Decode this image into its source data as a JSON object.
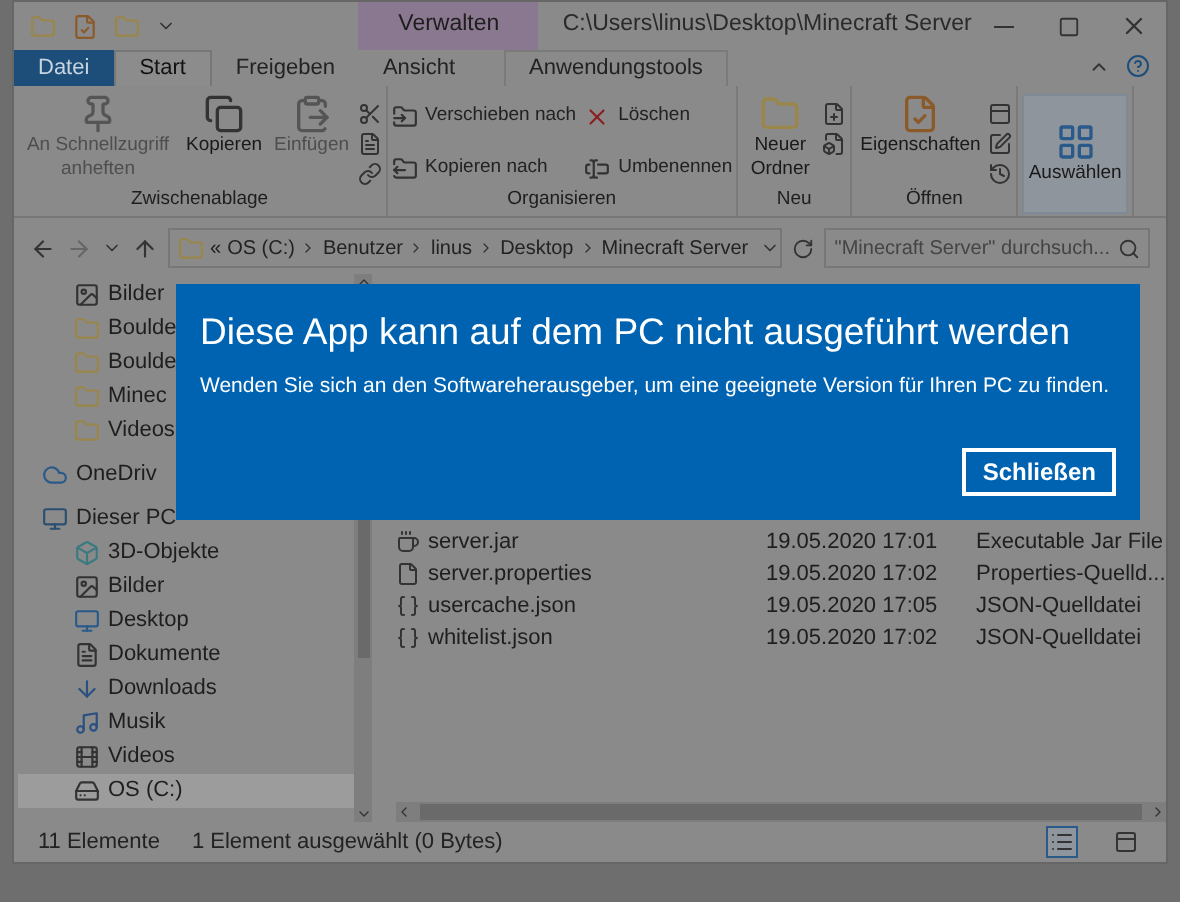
{
  "window": {
    "title": "C:\\Users\\linus\\Desktop\\Minecraft Server",
    "context_tab": "Verwalten"
  },
  "tabs": [
    {
      "label": "Datei",
      "selected": false
    },
    {
      "label": "Start",
      "selected": true
    },
    {
      "label": "Freigeben",
      "selected": false
    },
    {
      "label": "Ansicht",
      "selected": false
    },
    {
      "label": "Anwendungstools",
      "selected": false
    }
  ],
  "ribbon": {
    "groups": [
      {
        "label": "Zwischenablage",
        "buttons": [
          {
            "label": "An Schnellzugriff anheften",
            "disabled": true
          },
          {
            "label": "Kopieren",
            "disabled": false
          },
          {
            "label": "Einfügen",
            "disabled": true
          }
        ]
      },
      {
        "label": "Organisieren",
        "rows": [
          {
            "label": "Verschieben nach"
          },
          {
            "label": "Löschen"
          },
          {
            "label": "Kopieren nach"
          },
          {
            "label": "Umbenennen"
          }
        ]
      },
      {
        "label": "Neu",
        "buttons": [
          {
            "label": "Neuer Ordner",
            "disabled": false
          }
        ]
      },
      {
        "label": "Öffnen",
        "buttons": [
          {
            "label": "Eigenschaften",
            "disabled": false
          }
        ]
      },
      {
        "buttons": [
          {
            "label": "Auswählen",
            "disabled": false
          }
        ]
      }
    ]
  },
  "address": {
    "crumbs": [
      "OS (C:)",
      "Benutzer",
      "linus",
      "Desktop",
      "Minecraft Server"
    ],
    "overflow": "«",
    "search_placeholder": "\"Minecraft Server\" durchsuch..."
  },
  "sidebar": {
    "sections": [
      {
        "items": [
          {
            "label": "Bilder",
            "selected": false
          },
          {
            "label": "Boulde",
            "selected": false
          },
          {
            "label": "Boulde",
            "selected": false
          },
          {
            "label": "Minec",
            "selected": false
          },
          {
            "label": "Videos",
            "selected": false
          }
        ]
      },
      {
        "items": [
          {
            "label": "OneDriv",
            "selected": false
          }
        ]
      },
      {
        "items": [
          {
            "label": "Dieser PC",
            "selected": false,
            "children": [
              {
                "label": "3D-Objekte",
                "selected": false
              },
              {
                "label": "Bilder",
                "selected": false
              },
              {
                "label": "Desktop",
                "selected": false
              },
              {
                "label": "Dokumente",
                "selected": false
              },
              {
                "label": "Downloads",
                "selected": false
              },
              {
                "label": "Musik",
                "selected": false
              },
              {
                "label": "Videos",
                "selected": false
              },
              {
                "label": "OS (C:)",
                "selected": true
              }
            ]
          }
        ]
      }
    ]
  },
  "files": [
    {
      "name": "server.jar",
      "date": "19.05.2020 17:01",
      "type": "Executable Jar File"
    },
    {
      "name": "server.properties",
      "date": "19.05.2020 17:02",
      "type": "Properties-Quelld..."
    },
    {
      "name": "usercache.json",
      "date": "19.05.2020 17:05",
      "type": "JSON-Quelldatei"
    },
    {
      "name": "whitelist.json",
      "date": "19.05.2020 17:02",
      "type": "JSON-Quelldatei"
    }
  ],
  "status_bar": {
    "count": "11 Elemente",
    "selection": "1 Element ausgewählt (0 Bytes)",
    "views": [
      {
        "selected": true
      },
      {
        "selected": false
      }
    ]
  },
  "dialog": {
    "title": "Diese App kann auf dem PC nicht ausgeführt werden",
    "message": "Wenden Sie sich an den Softwareherausgeber, um eine geeignete Version für Ihren PC zu finden.",
    "button": "Schließen"
  }
}
